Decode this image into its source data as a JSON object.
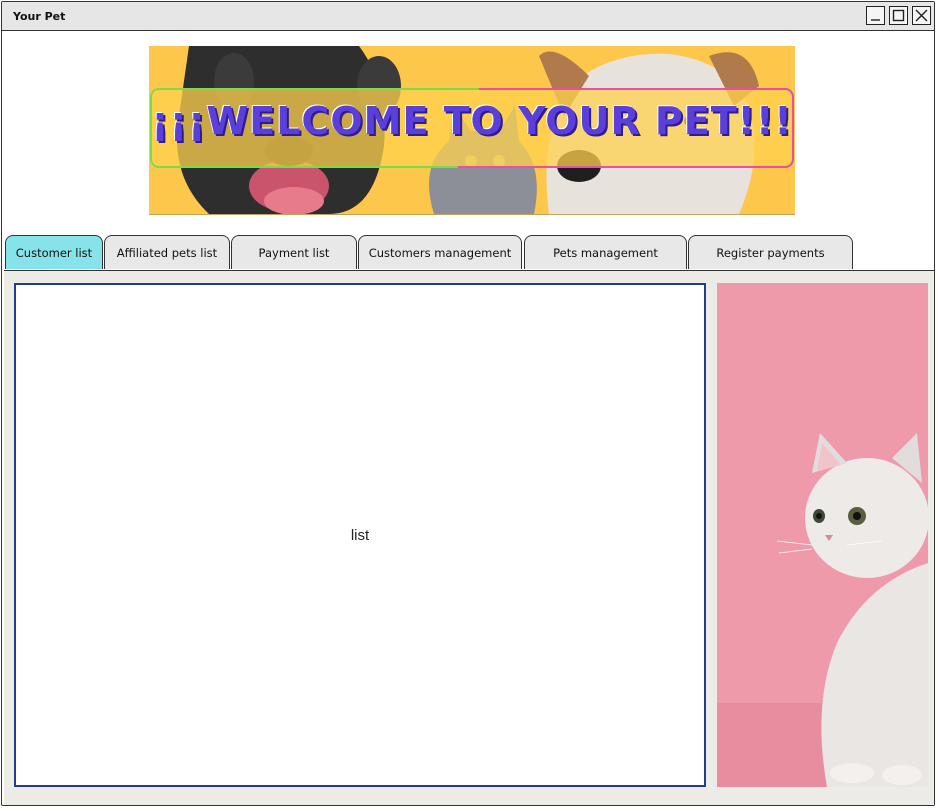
{
  "window": {
    "title": "Your Pet",
    "controls": {
      "minimize_icon": "minimize-icon",
      "maximize_icon": "maximize-icon",
      "close_icon": "close-icon"
    }
  },
  "banner": {
    "text": "¡¡¡WELCOME TO YOUR PET!!!",
    "background_color": "#fcc74a",
    "text_color": "#5a3fd8"
  },
  "tabs": [
    {
      "label": "Customer list",
      "active": true
    },
    {
      "label": "Affiliated pets list",
      "active": false
    },
    {
      "label": "Payment list",
      "active": false
    },
    {
      "label": "Customers management",
      "active": false
    },
    {
      "label": "Pets management",
      "active": false
    },
    {
      "label": "Register payments",
      "active": false
    }
  ],
  "main": {
    "list_placeholder": "list",
    "side_image": "cat-photo"
  },
  "colors": {
    "active_tab": "#86e3ea",
    "panel_background": "#edebe5",
    "list_border": "#243c8c"
  }
}
